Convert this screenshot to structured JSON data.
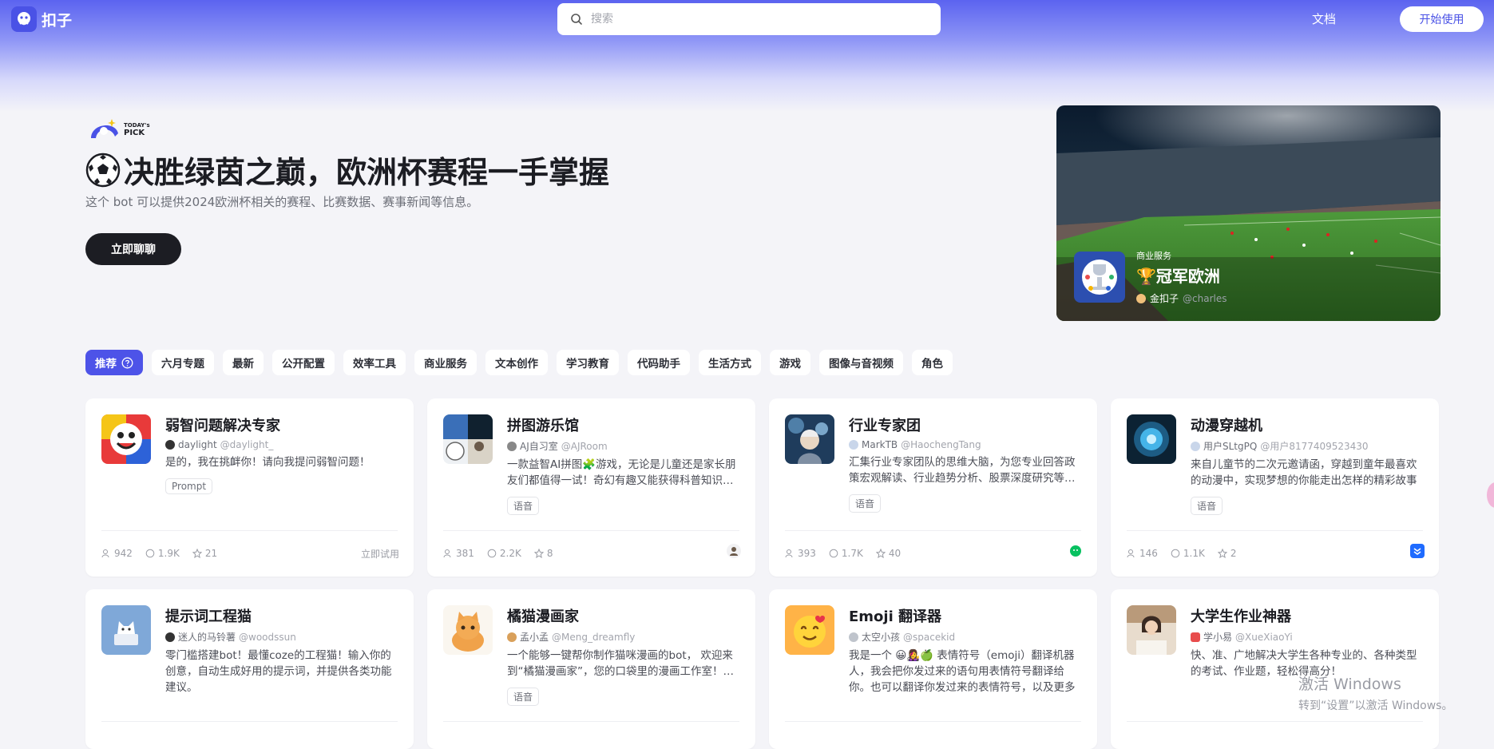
{
  "brand": {
    "name": "扣子"
  },
  "search": {
    "placeholder": "搜索"
  },
  "nav": {
    "docs": "文档",
    "start": "开始使用"
  },
  "hero": {
    "badge_line1": "TODAY's",
    "badge_line2": "PICK",
    "title": "决胜绿茵之巅，欧洲杯赛程一手掌握",
    "desc": "这个 bot 可以提供2024欧洲杯相关的赛程、比赛数据、赛事新闻等信息。",
    "cta": "立即聊聊"
  },
  "banner": {
    "category": "商业服务",
    "name": "冠军欧洲",
    "author": "金扣子",
    "handle": "@charles"
  },
  "tabs": [
    {
      "label": "推荐",
      "active": true
    },
    {
      "label": "六月专题"
    },
    {
      "label": "最新"
    },
    {
      "label": "公开配置"
    },
    {
      "label": "效率工具"
    },
    {
      "label": "商业服务"
    },
    {
      "label": "文本创作"
    },
    {
      "label": "学习教育"
    },
    {
      "label": "代码助手"
    },
    {
      "label": "生活方式"
    },
    {
      "label": "游戏"
    },
    {
      "label": "图像与音视频"
    },
    {
      "label": "角色"
    }
  ],
  "cards": [
    {
      "title": "弱智问题解决专家",
      "author": "daylight",
      "handle": "@daylight_",
      "desc": "是的，我在挑衅你！请向我提问弱智问题！",
      "tag": "Prompt",
      "users": "942",
      "chats": "1.9K",
      "stars": "21",
      "action": "立即试用"
    },
    {
      "title": "拼图游乐馆",
      "author": "AJ自习室",
      "handle": "@AJRoom",
      "desc": "一款益智AI拼图🧩游戏，无论是儿童还是家长朋友们都值得一试！奇幻有趣又能获得科普知识的拼图游戏，快来试试吧",
      "tag": "语音",
      "users": "381",
      "chats": "2.2K",
      "stars": "8",
      "platform": "avatar"
    },
    {
      "title": "行业专家团",
      "author": "MarkTB",
      "handle": "@HaochengTang",
      "desc": "汇集行业专家团队的思维大脑，为您专业回答政策宏观解读、行业趋势分析、股票深度研究等问题",
      "tag": "语音",
      "users": "393",
      "chats": "1.7K",
      "stars": "40",
      "platform": "wechat"
    },
    {
      "title": "动漫穿越机",
      "author": "用户SLtgPQ",
      "handle": "@用户8177409523430",
      "desc": "来自儿童节的二次元邀请函，穿越到童年最喜欢的动漫中，实现梦想的你能走出怎样的精彩故事",
      "tag": "语音",
      "users": "146",
      "chats": "1.1K",
      "stars": "2",
      "platform": "feishu"
    },
    {
      "title": "提示词工程猫",
      "author": "迷人的马铃薯",
      "handle": "@woodssun",
      "desc": "零门槛搭建bot！最懂coze的工程猫！输入你的创意，自动生成好用的提示词，并提供各类功能建议。"
    },
    {
      "title": "橘猫漫画家",
      "author": "孟小孟",
      "handle": "@Meng_dreamfly",
      "desc": "一个能够一键帮你制作猫咪漫画的bot， 欢迎来到“橘猫漫画家”，您的口袋里的漫画工作室！让您的故事和想法通过猫咪漫画的形式活灵活现",
      "tag": "语音"
    },
    {
      "title": "Emoji 翻译器",
      "author": "太空小孩",
      "handle": "@spacekid",
      "desc": "我是一个 😀👩‍🎤🍏 表情符号（emoji）翻译机器人，我会把你发过来的语句用表情符号翻译给你。也可以翻译你发过来的表情符号，以及更多"
    },
    {
      "title": "大学生作业神器",
      "author": "学小易",
      "handle": "@XueXiaoYi",
      "desc": "快、准、广地解决大学生各种专业的、各种类型的考试、作业题，轻松得高分！"
    }
  ],
  "watermark": {
    "title": "激活 Windows",
    "sub": "转到“设置”以激活 Windows。"
  },
  "colors": {
    "accent": "#4d53e8",
    "dark_button": "#1c1d23",
    "background": "#f4f4f8"
  }
}
